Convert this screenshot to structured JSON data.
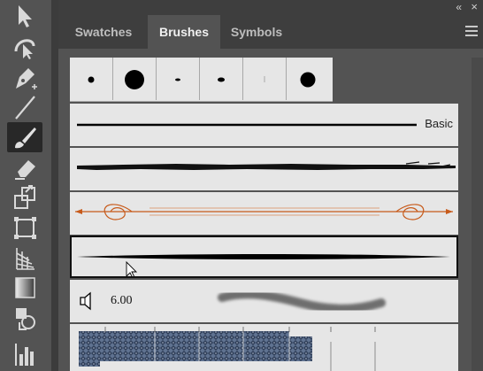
{
  "panel": {
    "collapse_glyph": "«",
    "close_glyph": "×",
    "tabs": [
      {
        "label": "Swatches"
      },
      {
        "label": "Brushes"
      },
      {
        "label": "Symbols"
      }
    ],
    "active_tab": "Brushes"
  },
  "tools": [
    {
      "icon": "selection-arrow-icon"
    },
    {
      "icon": "curvature-icon"
    },
    {
      "icon": "pen-icon"
    },
    {
      "icon": "line-segment-icon"
    },
    {
      "icon": "paintbrush-icon",
      "active": true
    },
    {
      "icon": "eraser-icon"
    },
    {
      "icon": "scale-icon"
    },
    {
      "icon": "free-transform-icon"
    },
    {
      "icon": "perspective-grid-icon"
    },
    {
      "icon": "gradient-icon"
    },
    {
      "icon": "shape-builder-icon"
    },
    {
      "icon": "column-graph-icon"
    }
  ],
  "brushes": {
    "calligraphic": [
      "dot-small",
      "dot-large",
      "dash-small",
      "oval-small",
      "hairline",
      "dot-medium"
    ],
    "basic_label": "Basic",
    "scatter_size": "6.00",
    "selected_row": "tapered-art-brush"
  }
}
